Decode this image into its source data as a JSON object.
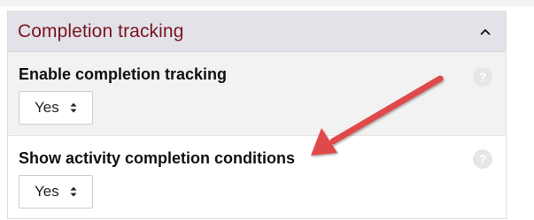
{
  "panel": {
    "title": "Completion tracking"
  },
  "settings": [
    {
      "label": "Enable completion tracking",
      "value": "Yes"
    },
    {
      "label": "Show activity completion conditions",
      "value": "Yes"
    }
  ],
  "help_icon_glyph": "?",
  "icons": [
    "chevron-up-icon",
    "help-icon",
    "select-caret-icon",
    "red-arrow-annotation"
  ],
  "colors": {
    "header_bg": "#e2e2e8",
    "title": "#7a1420",
    "row_alt": "#f2f2f2",
    "arrow": "#e04848"
  }
}
